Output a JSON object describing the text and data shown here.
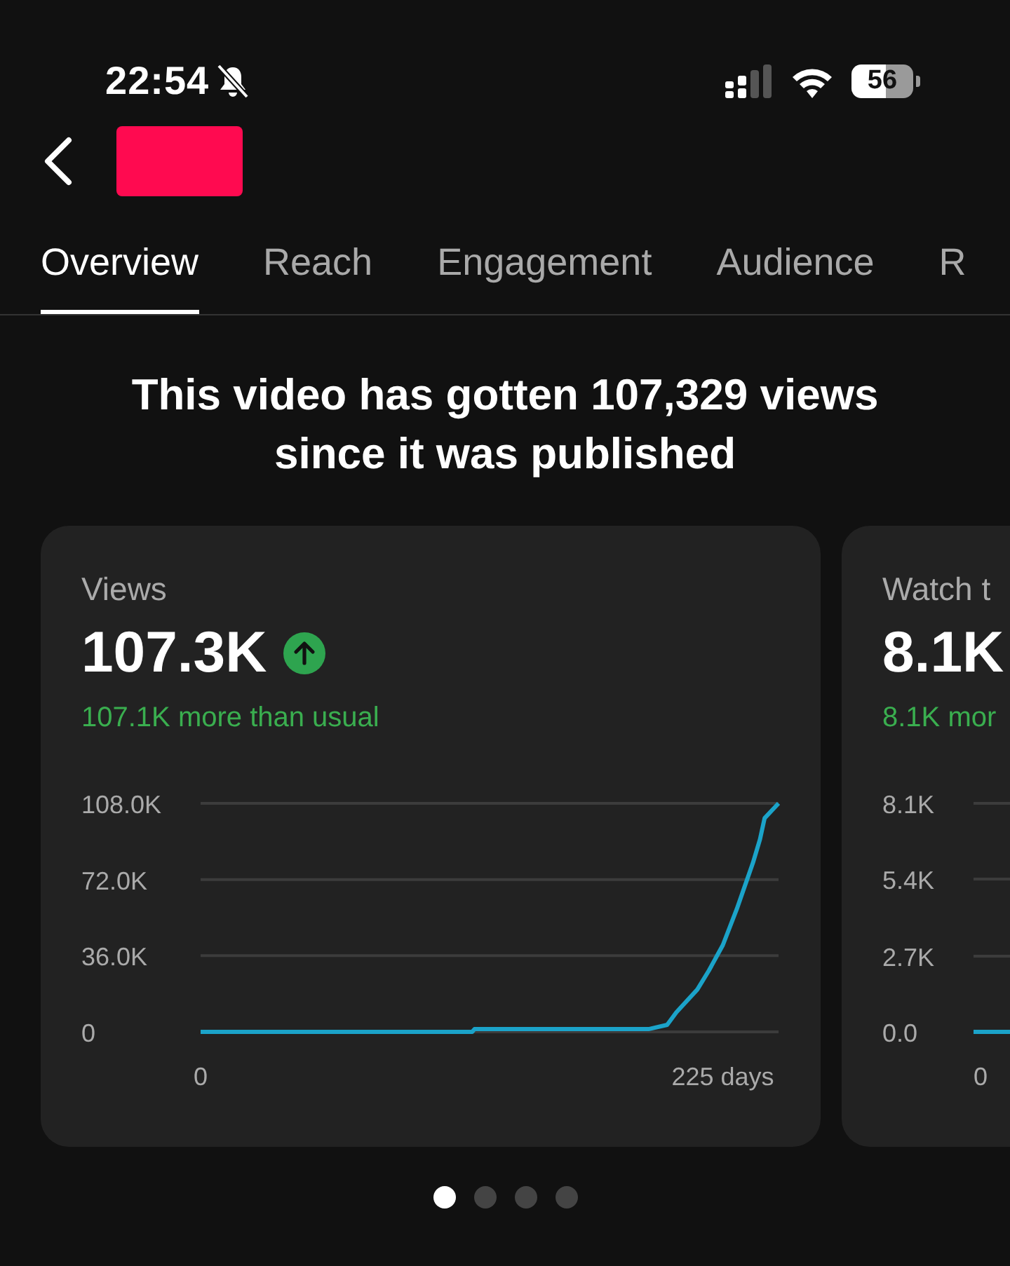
{
  "status_bar": {
    "time": "22:54",
    "battery": "56"
  },
  "tabs": [
    {
      "label": "Overview",
      "selected": true
    },
    {
      "label": "Reach",
      "selected": false
    },
    {
      "label": "Engagement",
      "selected": false
    },
    {
      "label": "Audience",
      "selected": false
    },
    {
      "label": "R",
      "selected": false
    }
  ],
  "headline": "This video has gotten 107,329 views since it was published",
  "cards": [
    {
      "title": "Views",
      "value": "107.3K",
      "up_indicator": true,
      "comparison": "107.1K more than usual",
      "chart_data": {
        "type": "line",
        "x": [
          0,
          117,
          118,
          193,
          201,
          205,
          214,
          219,
          225,
          231,
          238,
          241,
          243,
          249
        ],
        "series": [
          {
            "color": "#1ba3c9",
            "values": [
              0,
              0,
              1300,
              1300,
              3300,
              9300,
              20000,
              29000,
              41000,
              58000,
              80000,
              91000,
              101000,
              108000
            ]
          }
        ],
        "xlim": [
          0,
          249
        ],
        "ylim": [
          0,
          108000
        ],
        "yticks": [
          {
            "value": 0,
            "label": "0"
          },
          {
            "value": 36000,
            "label": "36.0K"
          },
          {
            "value": 72000,
            "label": "72.0K"
          },
          {
            "value": 108000,
            "label": "108.0K"
          }
        ],
        "xticks": [
          {
            "value": 0,
            "label": "0"
          },
          {
            "value": 225,
            "label": "225 days"
          }
        ]
      }
    },
    {
      "title": "Watch t",
      "value": "8.1K",
      "comparison": "8.1K mor",
      "y_axis_labels": [
        "8.1K",
        "5.4K",
        "2.7K",
        "0.0"
      ],
      "x_axis_labels": [
        "0"
      ]
    }
  ],
  "pager": [
    {
      "selected": true
    },
    {
      "selected": false
    },
    {
      "selected": false
    },
    {
      "selected": false
    }
  ]
}
